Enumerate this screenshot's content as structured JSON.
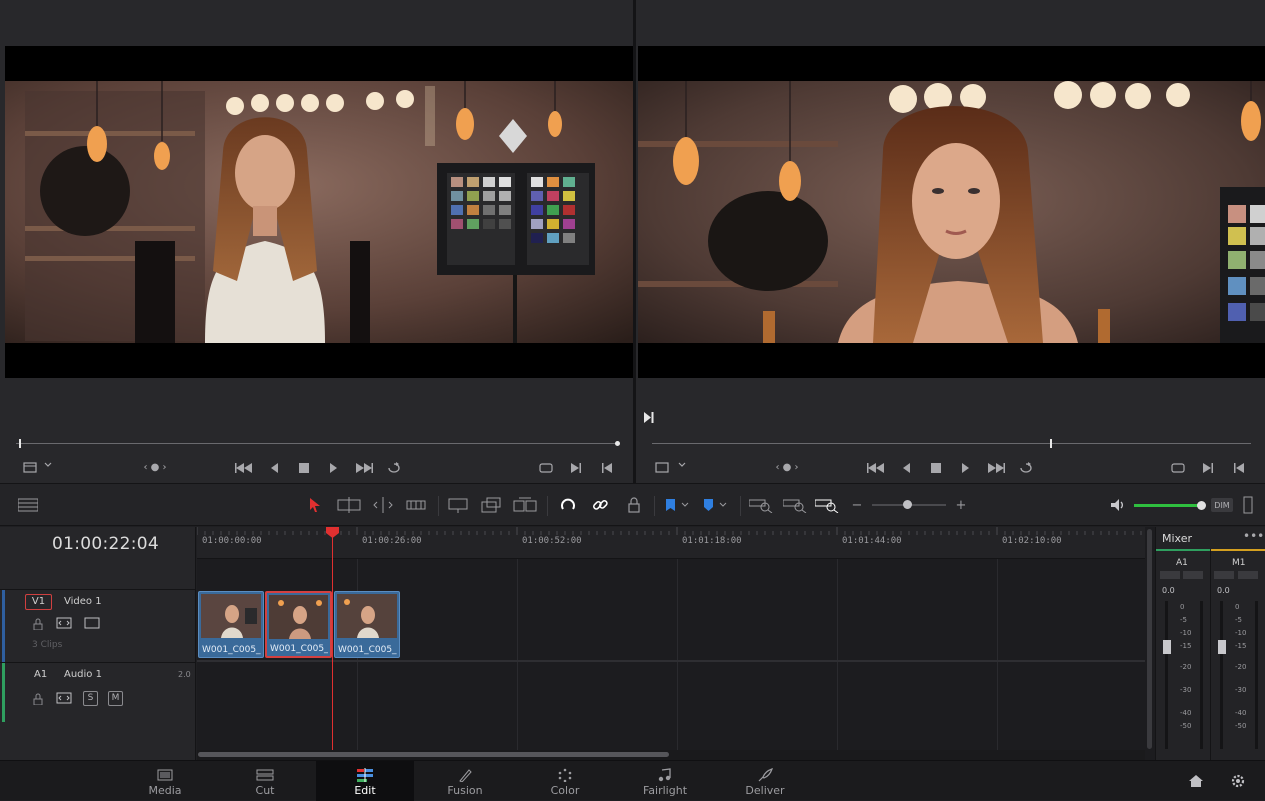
{
  "source_viewer": {
    "transport_icons": [
      "clip-view-icon",
      "chevron-down-icon",
      "jog-icon",
      "skip-to-start-icon",
      "play-reverse-icon",
      "stop-icon",
      "play-icon",
      "skip-to-end-icon",
      "loop-icon",
      "match-frame-icon",
      "next-edit-icon",
      "prev-edit-icon"
    ]
  },
  "timeline_viewer": {
    "transport_icons": [
      "clip-view-icon",
      "chevron-down-icon",
      "jog-icon",
      "skip-to-start-icon",
      "play-reverse-icon",
      "stop-icon",
      "play-icon",
      "skip-to-end-icon",
      "loop-icon",
      "match-frame-icon",
      "next-edit-icon",
      "prev-edit-icon"
    ]
  },
  "toolbar": {
    "tools": [
      "layout-icon",
      "selection-arrow-icon",
      "trim-icon",
      "dynamic-trim-icon",
      "blade-icon",
      "insert-clip-icon",
      "overwrite-clip-icon",
      "replace-clip-icon",
      "snapping-icon",
      "link-icon",
      "lock-icon",
      "flag-icon",
      "marker-icon",
      "zoom-full-icon",
      "zoom-detail-icon",
      "zoom-custom-icon",
      "zoom-out-icon",
      "zoom-in-icon",
      "volume-icon"
    ],
    "dim_label": "DIM",
    "accent_color": "#e03030",
    "volume_color": "#2fbf3f"
  },
  "timeline": {
    "timecode": "01:00:22:04",
    "ruler": [
      "01:00:00:00",
      "01:00:26:00",
      "01:00:52:00",
      "01:01:18:00",
      "01:01:44:00",
      "01:02:10:00"
    ],
    "video_track": {
      "id": "V1",
      "name": "Video 1",
      "clips_count": "3 Clips",
      "clips": [
        {
          "name": "W001_C005_..."
        },
        {
          "name": "W001_C005_..."
        },
        {
          "name": "W001_C005_..."
        }
      ]
    },
    "audio_track": {
      "id": "A1",
      "name": "Audio 1",
      "channels": "2.0",
      "solo_label": "S",
      "mute_label": "M"
    }
  },
  "mixer": {
    "title": "Mixer",
    "channels": [
      {
        "name": "A1",
        "level": "0.0"
      },
      {
        "name": "M1",
        "level": "0.0"
      }
    ],
    "scale": [
      "0",
      "-5",
      "-10",
      "-15",
      "-20",
      "-30",
      "-40",
      "-50"
    ]
  },
  "page_nav": {
    "pages": [
      {
        "label": "Media",
        "icon": "media-icon"
      },
      {
        "label": "Cut",
        "icon": "cut-icon"
      },
      {
        "label": "Edit",
        "icon": "edit-icon"
      },
      {
        "label": "Fusion",
        "icon": "fusion-icon"
      },
      {
        "label": "Color",
        "icon": "color-icon"
      },
      {
        "label": "Fairlight",
        "icon": "fairlight-icon"
      },
      {
        "label": "Deliver",
        "icon": "deliver-icon"
      }
    ],
    "active": "Edit"
  }
}
